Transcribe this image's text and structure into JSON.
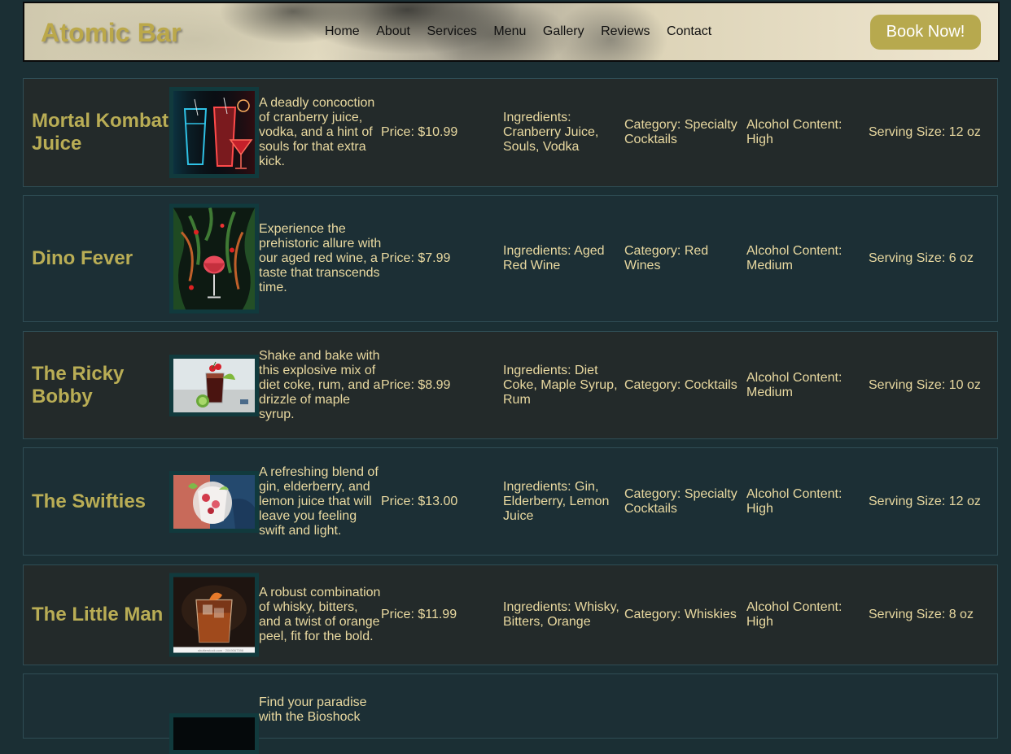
{
  "header": {
    "logo": "Atomic Bar",
    "nav": [
      "Home",
      "About",
      "Services",
      "Menu",
      "Gallery",
      "Reviews",
      "Contact"
    ],
    "book_button": "Book Now!"
  },
  "menu": [
    {
      "name": "Mortal Kombat Juice",
      "description": "A deadly concoction of cranberry juice, vodka, and a hint of souls for that extra kick.",
      "price": "Price: $10.99",
      "ingredients": "Ingredients: Cranberry Juice, Souls, Vodka",
      "category": "Category: Specialty Cocktails",
      "alcohol": "Alcohol Content: High",
      "serving": "Serving Size: 12 oz"
    },
    {
      "name": "Dino Fever",
      "description": "Experience the prehistoric allure with our aged red wine, a taste that transcends time.",
      "price": "Price: $7.99",
      "ingredients": "Ingredients: Aged Red Wine",
      "category": "Category: Red Wines",
      "alcohol": "Alcohol Content: Medium",
      "serving": "Serving Size: 6 oz"
    },
    {
      "name": "The Ricky Bobby",
      "description": "Shake and bake with this explosive mix of diet coke, rum, and a drizzle of maple syrup.",
      "price": "Price: $8.99",
      "ingredients": "Ingredients: Diet Coke, Maple Syrup, Rum",
      "category": "Category: Cocktails",
      "alcohol": "Alcohol Content: Medium",
      "serving": "Serving Size: 10 oz"
    },
    {
      "name": "The Swifties",
      "description": "A refreshing blend of gin, elderberry, and lemon juice that will leave you feeling swift and light.",
      "price": "Price: $13.00",
      "ingredients": "Ingredients: Gin, Elderberry, Lemon Juice",
      "category": "Category: Specialty Cocktails",
      "alcohol": "Alcohol Content: High",
      "serving": "Serving Size: 12 oz"
    },
    {
      "name": "The Little Man",
      "description": "A robust combination of whisky, bitters, and a twist of orange peel, fit for the bold.",
      "price": "Price: $11.99",
      "ingredients": "Ingredients: Whisky, Bitters, Orange",
      "category": "Category: Whiskies",
      "alcohol": "Alcohol Content: High",
      "serving": "Serving Size: 8 oz"
    },
    {
      "description": "Find your paradise with the Bioshock"
    }
  ]
}
